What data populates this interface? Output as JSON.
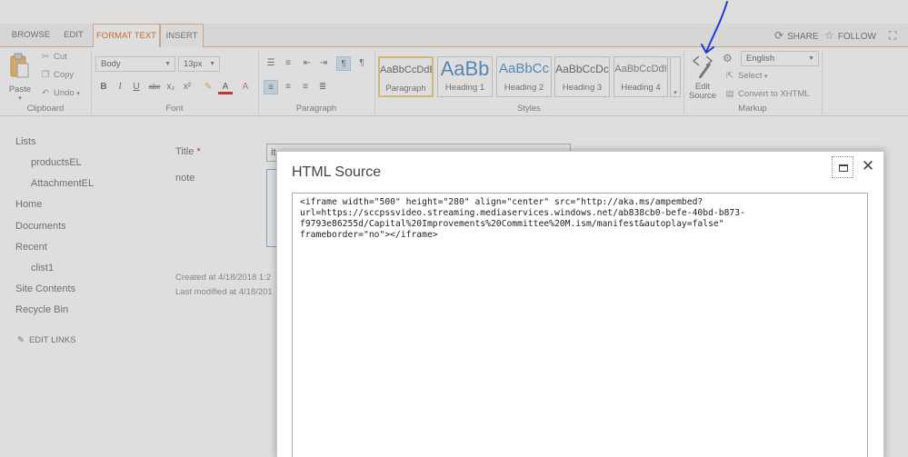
{
  "tabs": [
    {
      "label": "BROWSE"
    },
    {
      "label": "EDIT"
    },
    {
      "label": "FORMAT TEXT"
    },
    {
      "label": "INSERT"
    }
  ],
  "top_actions": {
    "share": "SHARE",
    "follow": "FOLLOW"
  },
  "ribbon": {
    "clipboard": {
      "paste": "Paste",
      "cut": "Cut",
      "copy": "Copy",
      "undo": "Undo",
      "label": "Clipboard"
    },
    "font": {
      "family": "Body",
      "size": "13px",
      "label": "Font",
      "buttons": [
        "B",
        "I",
        "U",
        "abc",
        "x₂",
        "x²"
      ]
    },
    "paragraph": {
      "label": "Paragraph"
    },
    "styles": {
      "label": "Styles",
      "tiles": [
        {
          "sample": "AaBbCcDdE",
          "name": "Paragraph"
        },
        {
          "sample": "AaBb",
          "name": "Heading 1"
        },
        {
          "sample": "AaBbCc",
          "name": "Heading 2"
        },
        {
          "sample": "AaBbCcDc",
          "name": "Heading 3"
        },
        {
          "sample": "AaBbCcDdI",
          "name": "Heading 4"
        }
      ]
    },
    "markup": {
      "edit_source_line1": "Edit",
      "edit_source_line2": "Source",
      "language": "English",
      "select": "Select",
      "convert": "Convert to XHTML",
      "label": "Markup"
    }
  },
  "leftnav": {
    "lists": "Lists",
    "products": "productsEL",
    "attachment": "AttachmentEL",
    "home": "Home",
    "documents": "Documents",
    "recent": "Recent",
    "clist1": "clist1",
    "site_contents": "Site Contents",
    "recycle_bin": "Recycle Bin",
    "edit_links": "EDIT LINKS"
  },
  "form": {
    "title_label": "Title",
    "required_mark": "*",
    "title_value": "it",
    "note_label": "note",
    "created": "Created at 4/18/2018 1:2",
    "modified": "Last modified at 4/18/201"
  },
  "dialog": {
    "title": "HTML Source",
    "source": "<iframe width=\"500\" height=\"280\" align=\"center\" src=\"http://aka.ms/ampembed?\nurl=https://sccpssvideo.streaming.mediaservices.windows.net/ab838cb0-befe-40bd-b873-\nf9793e86255d/Capital%20Improvements%20Committee%20M.ism/manifest&autoplay=false\"\nframeborder=\"no\"></iframe>"
  },
  "colors": {
    "accent": "#d35400",
    "annotation": "#1f3bd6",
    "heading_blue": "#2e7ab8"
  }
}
